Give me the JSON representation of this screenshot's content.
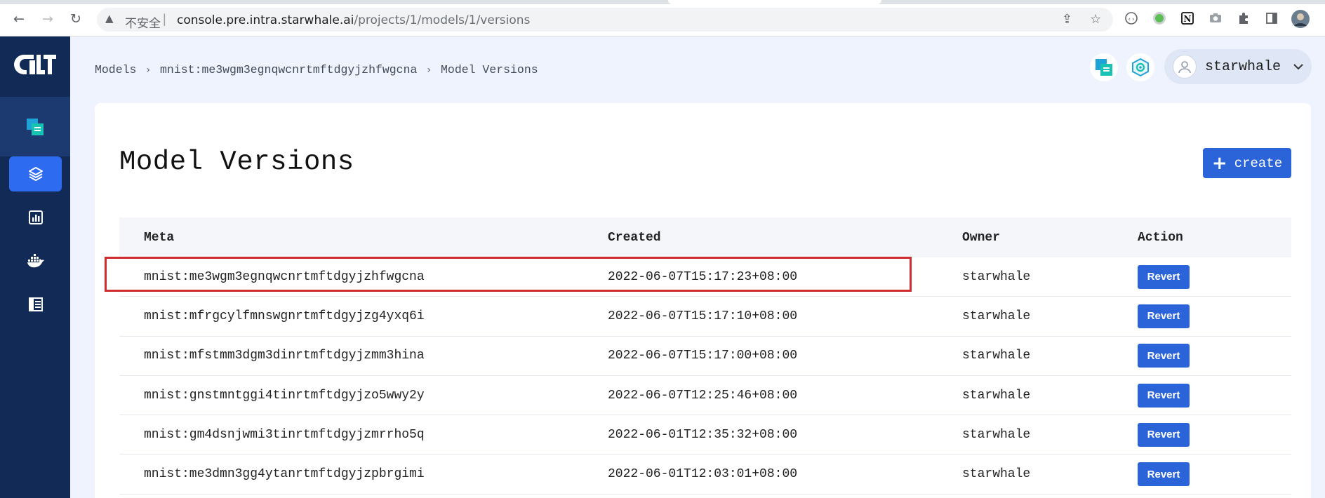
{
  "browser": {
    "security_label": "不安全",
    "url_host": "console.pre.intra.starwhale.ai",
    "url_path": "/projects/1/models/1/versions",
    "icons": [
      "back-arrow-icon",
      "forward-arrow-icon",
      "reload-icon",
      "warning-icon",
      "share-icon",
      "star-icon",
      "code-icon",
      "green-dot-icon",
      "notion-icon",
      "camera-icon",
      "puzzle-icon",
      "sidepanel-icon",
      "profile-icon"
    ]
  },
  "sidebar": {
    "logo": "starwhale-logo",
    "items": [
      {
        "name": "projects",
        "icon": "project-icon",
        "active": false
      },
      {
        "name": "models",
        "icon": "layers-icon",
        "active": true
      },
      {
        "name": "evaluations",
        "icon": "chart-icon",
        "active": false
      },
      {
        "name": "runtimes",
        "icon": "docker-icon",
        "active": false
      },
      {
        "name": "datasets",
        "icon": "dataset-icon",
        "active": false
      }
    ]
  },
  "breadcrumb": [
    "Models",
    "mnist:me3wgm3egnqwcnrtmftdgyjzhfwgcna",
    "Model Versions"
  ],
  "user": {
    "name": "starwhale"
  },
  "main": {
    "title": "Model Versions",
    "create_label": "create"
  },
  "table": {
    "headers": {
      "meta": "Meta",
      "created": "Created",
      "owner": "Owner",
      "action": "Action"
    },
    "rows": [
      {
        "meta": "mnist:me3wgm3egnqwcnrtmftdgyjzhfwgcna",
        "created": "2022-06-07T15:17:23+08:00",
        "owner": "starwhale",
        "action": "Revert",
        "highlighted": true
      },
      {
        "meta": "mnist:mfrgcylfmnswgnrtmftdgyjzg4yxq6i",
        "created": "2022-06-07T15:17:10+08:00",
        "owner": "starwhale",
        "action": "Revert"
      },
      {
        "meta": "mnist:mfstmm3dgm3dinrtmftdgyjzmm3hina",
        "created": "2022-06-07T15:17:00+08:00",
        "owner": "starwhale",
        "action": "Revert"
      },
      {
        "meta": "mnist:gnstmntggi4tinrtmftdgyjzo5wwy2y",
        "created": "2022-06-07T12:25:46+08:00",
        "owner": "starwhale",
        "action": "Revert"
      },
      {
        "meta": "mnist:gm4dsnjwmi3tinrtmftdgyjzmrrho5q",
        "created": "2022-06-01T12:35:32+08:00",
        "owner": "starwhale",
        "action": "Revert"
      },
      {
        "meta": "mnist:me3dmn3gg4ytanrtmftdgyjzpbrgimi",
        "created": "2022-06-01T12:03:01+08:00",
        "owner": "starwhale",
        "action": "Revert"
      }
    ]
  },
  "colors": {
    "sidebar_bg": "#122a56",
    "accent": "#2b63d9",
    "highlight": "#d12d30",
    "page_bg": "#eef3fd"
  }
}
